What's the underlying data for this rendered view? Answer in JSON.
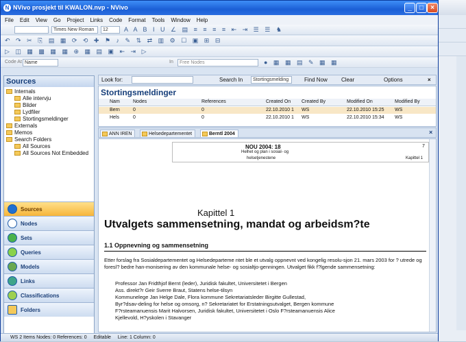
{
  "window": {
    "title": "NVivo prosjekt til KWALON.nvp - NVivo"
  },
  "menu": [
    "File",
    "Edit",
    "View",
    "Go",
    "Project",
    "Links",
    "Code",
    "Format",
    "Tools",
    "Window",
    "Help"
  ],
  "format": {
    "font": "Times New Roman",
    "size": "12"
  },
  "code_at": {
    "label": "Code At",
    "value": "Name",
    "in": "In",
    "in_value": "Free Nodes"
  },
  "sources": {
    "header": "Sources",
    "tree": [
      {
        "label": "Internals",
        "level": 0
      },
      {
        "label": "Alle intervju",
        "level": 1
      },
      {
        "label": "Bilder",
        "level": 1
      },
      {
        "label": "Lydfiler",
        "level": 1
      },
      {
        "label": "Stortingsmeldinger",
        "level": 1
      },
      {
        "label": "Externals",
        "level": 0
      },
      {
        "label": "Memos",
        "level": 0
      },
      {
        "label": "Search Folders",
        "level": 0
      },
      {
        "label": "All Sources",
        "level": 1
      },
      {
        "label": "All Sources Not Embedded",
        "level": 1
      }
    ]
  },
  "nav": [
    {
      "label": "Sources",
      "active": true
    },
    {
      "label": "Nodes",
      "active": false
    },
    {
      "label": "Sets",
      "active": false
    },
    {
      "label": "Queries",
      "active": false
    },
    {
      "label": "Models",
      "active": false
    },
    {
      "label": "Links",
      "active": false
    },
    {
      "label": "Classifications",
      "active": false
    },
    {
      "label": "Folders",
      "active": false
    }
  ],
  "find": {
    "look_for": "Look for:",
    "search_in": "Search In",
    "search_in_value": "Stortingsmelding",
    "find_now": "Find Now",
    "clear": "Clear",
    "options": "Options"
  },
  "list": {
    "title": "Stortingsmeldinger",
    "columns": [
      "Nam",
      "Nodes",
      "References",
      "Created On",
      "Created By",
      "Modified On",
      "Modified By"
    ],
    "rows": [
      [
        "Bern",
        "0",
        "0",
        "22.10.2010 1",
        "WS",
        "22.10.2010 15:25",
        "WS"
      ],
      [
        "Hels",
        "0",
        "0",
        "22.10.2010 1",
        "WS",
        "22.10.2010 15:34",
        "WS"
      ]
    ]
  },
  "tabs": [
    "ANN IREN",
    "Helsedepartementet",
    "Berntl 2004"
  ],
  "doc": {
    "hdr_title": "NOU 2004: 18",
    "hdr_line1": "Helhet og plan i sosial- og",
    "hdr_line2": "helsetjenestene",
    "hdr_page": "7",
    "hdr_chapter": "Kapittel 1",
    "chapter": "Kapittel 1",
    "heading": "Utvalgets sammensetning, mandat og arbeidsm?te",
    "section": "1.1   Oppnevning og sammensetning",
    "para": "Etter forslag fra Sosialdepartementet og Helsedeparteme ntet ble et utvalg oppnevnt ved kongelig resolu-sjon 21. mars 2003 for ? utrede og foresl? bedre han-monisering av den kommunale helse- og sosialtjo-genningen. Utvalget fikk f?lgende sammensetning:",
    "members": [
      "Professor Jan Fridthjof Bernt (leder), Juridisk fakultet, Universitetet i Bergen",
      "Ass. direkt?r Geir Sverre Braut, Statens helse-tilsyn",
      "Kommunelege Jan Helge Dale, Flora kommune Sekretariatsleder Birgitte Gullestad,",
      "Byr?dsav-deling for helse og omsorg, n? Sekretariatet for Erstatningsutvalget, Bergen kommune",
      "F?rsteamanuensis Marit Halvorsen, Juridisk fakultet, Universitetet i Oslo F?rsteamanuensis Alice",
      "Kjellevold, H?yskolen i Stavanger"
    ]
  },
  "status": {
    "items": "WS  2 Items   Nodes: 0   References: 0",
    "editable": "Editable",
    "line": "Line: 1  Column: 0"
  }
}
